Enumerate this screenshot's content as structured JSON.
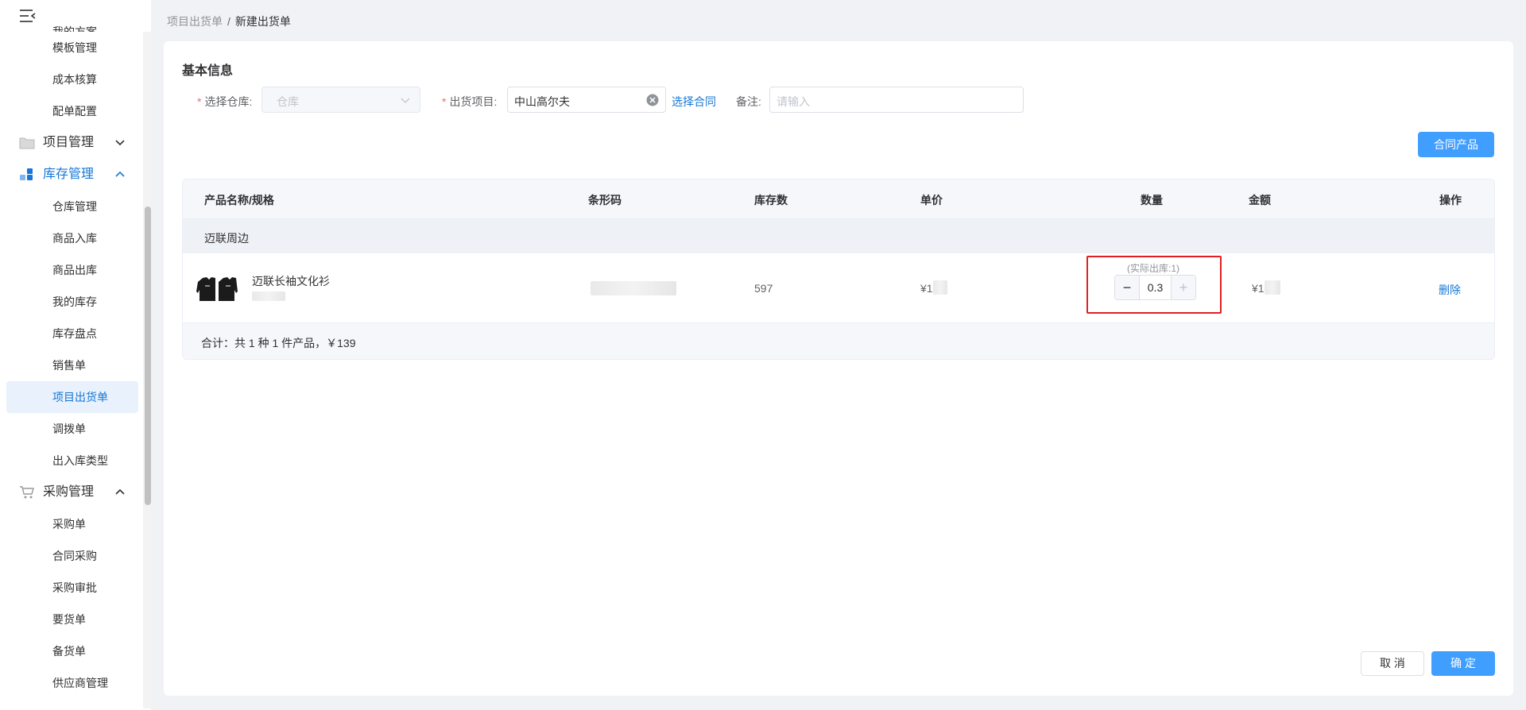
{
  "sidebar": {
    "items_top": [
      {
        "label": "我的方案",
        "clipped": true
      },
      {
        "label": "模板管理"
      },
      {
        "label": "成本核算"
      },
      {
        "label": "配单配置"
      }
    ],
    "group_project": {
      "label": "项目管理"
    },
    "group_inventory": {
      "label": "库存管理"
    },
    "inventory_items": [
      {
        "label": "仓库管理"
      },
      {
        "label": "商品入库"
      },
      {
        "label": "商品出库"
      },
      {
        "label": "我的库存"
      },
      {
        "label": "库存盘点"
      },
      {
        "label": "销售单"
      },
      {
        "label": "项目出货单",
        "active": true
      },
      {
        "label": "调拨单"
      },
      {
        "label": "出入库类型"
      }
    ],
    "group_purchase": {
      "label": "采购管理"
    },
    "purchase_items": [
      {
        "label": "采购单"
      },
      {
        "label": "合同采购"
      },
      {
        "label": "采购审批"
      },
      {
        "label": "要货单"
      },
      {
        "label": "备货单"
      },
      {
        "label": "供应商管理"
      }
    ]
  },
  "breadcrumb": {
    "parent": "项目出货单",
    "separator": "/",
    "current": "新建出货单"
  },
  "form": {
    "section_title": "基本信息",
    "warehouse_label": "选择仓库:",
    "warehouse_placeholder": "仓库",
    "project_label": "出货项目:",
    "project_value": "中山高尔夫",
    "select_contract": "选择合同",
    "remark_label": "备注:",
    "remark_placeholder": "请输入",
    "required_mark": "*"
  },
  "actions": {
    "contract_products": "合同产品",
    "cancel": "取 消",
    "confirm": "确 定"
  },
  "table": {
    "headers": [
      "产品名称/规格",
      "条形码",
      "库存数",
      "单价",
      "数量",
      "金额",
      "操作"
    ],
    "group_name": "迈联周边",
    "rows": [
      {
        "name": "迈联长袖文化衫",
        "stock": "597",
        "price_prefix": "¥1",
        "amount_prefix": "¥1",
        "qty_hint": "(实际出库:1)",
        "qty": "0.3",
        "dec": "−",
        "inc": "+",
        "action": "删除"
      }
    ],
    "summary": "合计：共 1 种 1 件产品，￥139"
  },
  "colors": {
    "primary": "#409eff",
    "link": "#1677d6",
    "highlight_border": "#e02020",
    "danger": "#f56c6c"
  },
  "icons": {
    "menu_toggle": "menu-fold-icon",
    "project_group": "folder-icon",
    "inventory_group": "blocks-icon",
    "purchase_group": "cart-icon",
    "clear": "circle-close-icon",
    "select_arrow": "chevron-down-icon"
  }
}
